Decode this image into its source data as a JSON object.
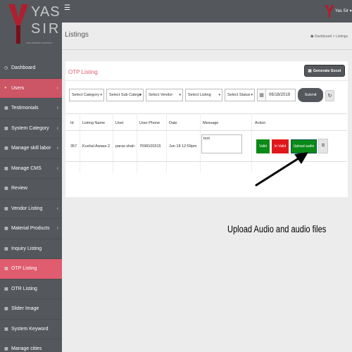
{
  "brand": {
    "name_line1": "YAS",
    "name_line2": "SIR",
    "tagline": "YOUR COMFORT IS OUR DUTY",
    "color": "#b01f2e"
  },
  "topbar": {
    "user_name": "Yas Sir"
  },
  "sidebar": {
    "items": [
      {
        "label": "Dashboard",
        "icon": "dashboard-icon",
        "chevron": false,
        "active": false
      },
      {
        "label": "Users",
        "icon": "user-icon",
        "chevron": true,
        "active": false
      },
      {
        "label": "Testimonials",
        "icon": "building-icon",
        "chevron": true,
        "active": false
      },
      {
        "label": "System Category",
        "icon": "building-icon",
        "chevron": true,
        "active": false
      },
      {
        "label": "Manage skill labor",
        "icon": "building-icon",
        "chevron": true,
        "active": false
      },
      {
        "label": "Manage CMS",
        "icon": "building-icon",
        "chevron": true,
        "active": false
      },
      {
        "label": "Review",
        "icon": "building-icon",
        "chevron": false,
        "active": false
      },
      {
        "label": "Vendor Listing",
        "icon": "building-icon",
        "chevron": true,
        "active": false
      },
      {
        "label": "Material Products",
        "icon": "building-icon",
        "chevron": true,
        "active": false
      },
      {
        "label": "Inquiry Listing",
        "icon": "building-icon",
        "chevron": false,
        "active": false
      },
      {
        "label": "OTP Listing",
        "icon": "building-icon",
        "chevron": false,
        "active": true
      },
      {
        "label": "OTR Listing",
        "icon": "building-icon",
        "chevron": false,
        "active": false
      },
      {
        "label": "Slider Image",
        "icon": "building-icon",
        "chevron": false,
        "active": false
      },
      {
        "label": "System Keyword",
        "icon": "building-icon",
        "chevron": false,
        "active": false
      },
      {
        "label": "Manage cities",
        "icon": "building-icon",
        "chevron": false,
        "active": false
      }
    ],
    "active_color": "#e05c6f"
  },
  "page": {
    "title": "Listings",
    "breadcrumb_home": "Dashboard",
    "breadcrumb_sep": ">",
    "breadcrumb_current": "Listings"
  },
  "card": {
    "title": "OTP Listing",
    "generate_label": "Generate Excel",
    "filters": {
      "category": "Select Category",
      "sub_category": "Select Sub Catego",
      "vendor": "Select Vendor",
      "listing": "Select Listing",
      "status": "Select Status",
      "date": "06/18/2019",
      "submit": "Submit"
    },
    "columns": [
      "Id",
      "Listing Name",
      "User",
      "User Phone",
      "Date",
      "Message",
      "Action"
    ],
    "rows": [
      {
        "id": "357",
        "listing_name": "Kushal Awaas 2",
        "user": "paras shah",
        "phone": "7698100315",
        "date": "Jun 18 12:59pm",
        "message": "test",
        "actions": {
          "valid": "Valid",
          "invalid": "In Valid",
          "upload": "Upload audio"
        }
      }
    ]
  },
  "annotation": {
    "text": "Upload Audio and audio files"
  },
  "colors": {
    "sidebar_bg": "#54575c",
    "valid": "#0a8a17",
    "invalid": "#e0181b",
    "upload": "#0a8a17"
  }
}
